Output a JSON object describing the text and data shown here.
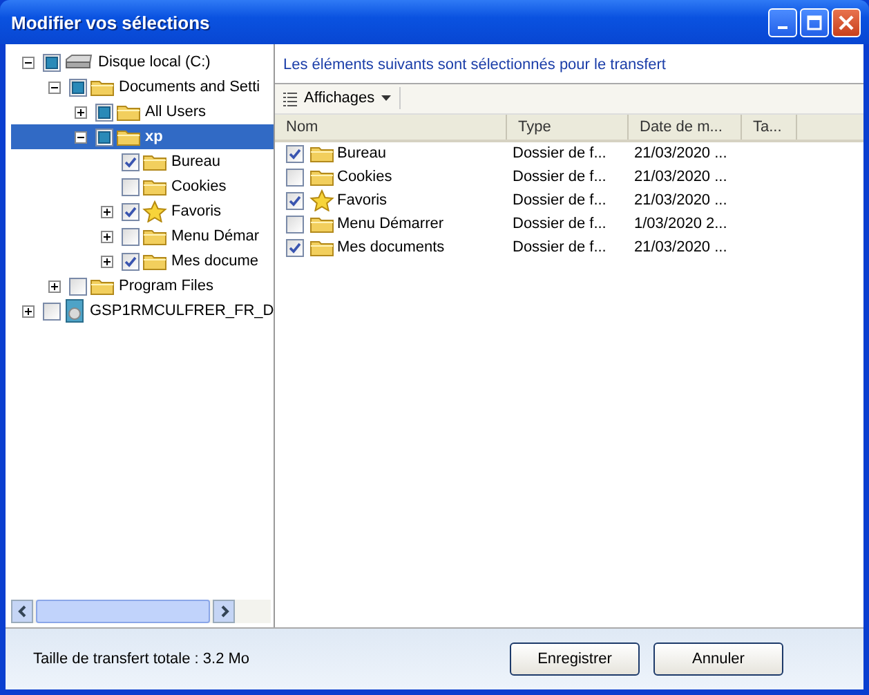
{
  "window": {
    "title": "Modifier vos sélections"
  },
  "tree": [
    {
      "label": "Disque local (C:)",
      "kind": "drive",
      "expanded": true,
      "checked": false,
      "partial": true,
      "selected": false,
      "children": [
        {
          "label": "Documents and Setti",
          "kind": "folder",
          "expanded": true,
          "checked": false,
          "partial": true,
          "selected": false,
          "children": [
            {
              "label": "All Users",
              "kind": "folder",
              "expanded": false,
              "checked": false,
              "partial": true,
              "selected": false
            },
            {
              "label": "xp",
              "kind": "folder",
              "expanded": true,
              "checked": false,
              "partial": true,
              "selected": true,
              "children": [
                {
                  "label": "Bureau",
                  "kind": "folder",
                  "checked": true,
                  "partial": false,
                  "selected": false
                },
                {
                  "label": "Cookies",
                  "kind": "folder",
                  "checked": false,
                  "partial": false,
                  "selected": false
                },
                {
                  "label": "Favoris",
                  "kind": "star",
                  "expanded": false,
                  "checked": true,
                  "partial": false,
                  "selected": false
                },
                {
                  "label": "Menu Démar",
                  "kind": "folder",
                  "expanded": false,
                  "checked": false,
                  "partial": false,
                  "selected": false
                },
                {
                  "label": "Mes docume",
                  "kind": "folder",
                  "expanded": false,
                  "checked": true,
                  "partial": false,
                  "selected": false
                }
              ]
            }
          ]
        },
        {
          "label": "Program Files",
          "kind": "folder",
          "expanded": false,
          "checked": false,
          "partial": false,
          "selected": false
        }
      ]
    },
    {
      "label": "GSP1RMCULFRER_FR_D",
      "kind": "disc",
      "expanded": false,
      "checked": false,
      "partial": false,
      "selected": false
    }
  ],
  "heading": "Les éléments suivants sont sélectionnés pour le transfert",
  "toolbar": {
    "views_button": "Affichages"
  },
  "table": {
    "columns": [
      "Nom",
      "Type",
      "Date de m...",
      "Ta..."
    ],
    "rows": [
      {
        "name": "Bureau",
        "kind": "folder",
        "checked": true,
        "type": "Dossier de f...",
        "date": "21/03/2020 ..."
      },
      {
        "name": "Cookies",
        "kind": "folder",
        "checked": false,
        "type": "Dossier de f...",
        "date": "21/03/2020 ..."
      },
      {
        "name": "Favoris",
        "kind": "star",
        "checked": true,
        "type": "Dossier de f...",
        "date": "21/03/2020 ..."
      },
      {
        "name": "Menu Démarrer",
        "kind": "folder",
        "checked": false,
        "type": "Dossier de f...",
        "date": "1/03/2020 2..."
      },
      {
        "name": "Mes documents",
        "kind": "folder",
        "checked": true,
        "type": "Dossier de f...",
        "date": "21/03/2020 ..."
      }
    ]
  },
  "footer": {
    "total": "Taille de transfert totale : 3.2 Mo",
    "buttons": [
      "Enregistrer",
      "Annuler"
    ]
  }
}
